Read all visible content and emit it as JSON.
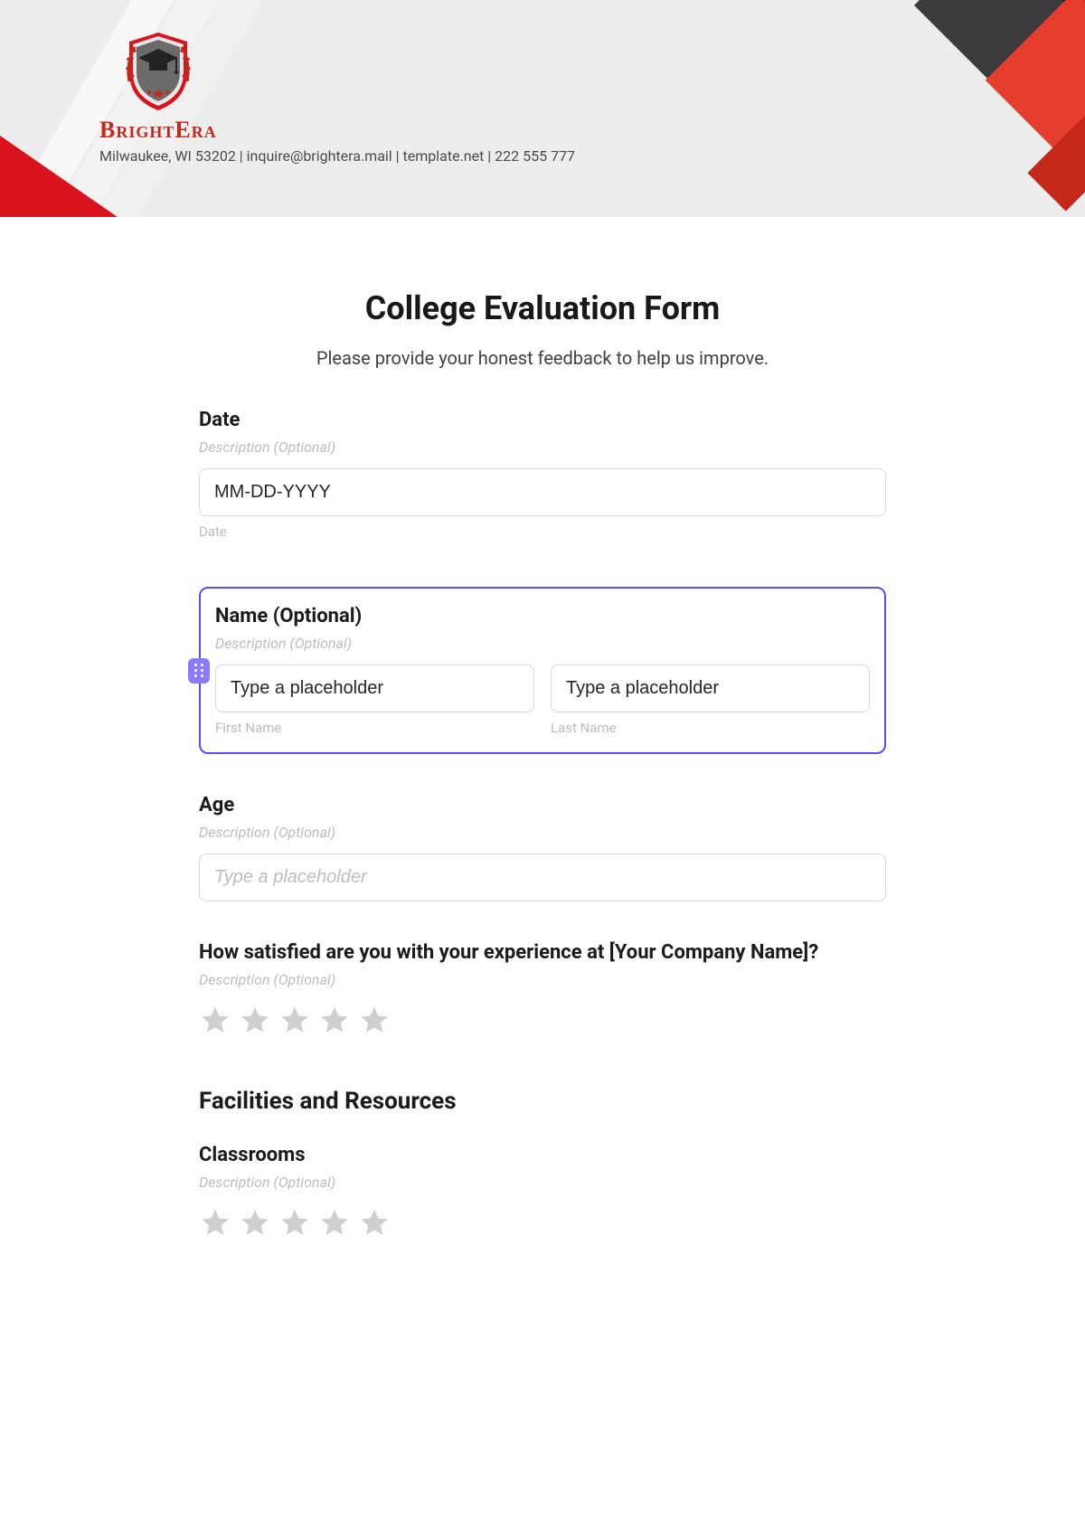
{
  "brand": {
    "name": "BrightEra",
    "contact": "Milwaukee, WI 53202 | inquire@brightera.mail | template.net | 222 555 777"
  },
  "form": {
    "title": "College Evaluation Form",
    "subtitle": "Please provide your honest feedback to help us improve."
  },
  "fields": {
    "date": {
      "label": "Date",
      "desc": "Description (Optional)",
      "placeholder": "MM-DD-YYYY",
      "sublabel": "Date"
    },
    "name": {
      "label": "Name (Optional)",
      "desc": "Description (Optional)",
      "first_placeholder": "Type a placeholder",
      "last_placeholder": "Type a placeholder",
      "first_sub": "First Name",
      "last_sub": "Last Name"
    },
    "age": {
      "label": "Age",
      "desc": "Description (Optional)",
      "placeholder": "Type a placeholder"
    },
    "satisfaction": {
      "label": "How satisfied are you with your experience at [Your Company Name]?",
      "desc": "Description (Optional)"
    },
    "section_facilities": "Facilities and Resources",
    "classrooms": {
      "label": "Classrooms",
      "desc": "Description (Optional)"
    }
  }
}
